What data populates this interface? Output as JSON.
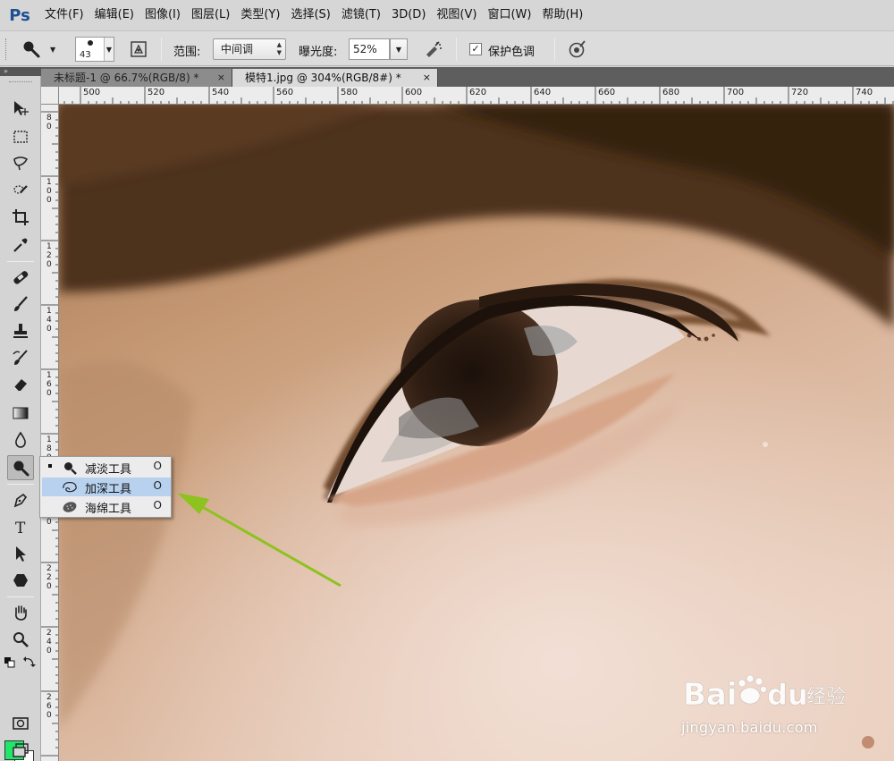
{
  "app": {
    "logo": "Ps"
  },
  "menu": [
    "文件(F)",
    "编辑(E)",
    "图像(I)",
    "图层(L)",
    "类型(Y)",
    "选择(S)",
    "滤镜(T)",
    "3D(D)",
    "视图(V)",
    "窗口(W)",
    "帮助(H)"
  ],
  "options": {
    "brush_size": "43",
    "range_label": "范围:",
    "range_value": "中间调",
    "exposure_label": "曝光度:",
    "exposure_value": "52%",
    "protect_tones_label": "保护色调",
    "protect_tones_checked": "✓"
  },
  "tabs": [
    {
      "label": "未标题-1 @ 66.7%(RGB/8) *",
      "close": "×",
      "active": false
    },
    {
      "label": "模特1.jpg @ 304%(RGB/8#) *",
      "close": "×",
      "active": true
    }
  ],
  "ruler": {
    "h_labels": [
      "500",
      "520",
      "540",
      "560",
      "580",
      "600",
      "620",
      "640",
      "660",
      "680",
      "700",
      "720",
      "740"
    ],
    "v_labels": [
      "80",
      "100",
      "120",
      "140",
      "160",
      "180",
      "200",
      "220",
      "240",
      "260"
    ]
  },
  "toolbar": {
    "header": "»"
  },
  "colors": {
    "foreground": "#22e56b",
    "background": "#ffffff",
    "arrow": "#8dc21f"
  },
  "flyout": {
    "items": [
      {
        "label": "减淡工具",
        "key": "O",
        "icon": "dodge-icon",
        "selected": true,
        "highlighted": false
      },
      {
        "label": "加深工具",
        "key": "O",
        "icon": "burn-icon",
        "selected": false,
        "highlighted": true
      },
      {
        "label": "海绵工具",
        "key": "O",
        "icon": "sponge-icon",
        "selected": false,
        "highlighted": false
      }
    ]
  },
  "watermark": {
    "logo": "Bai du 经验",
    "url": "jingyan.baidu.com"
  }
}
